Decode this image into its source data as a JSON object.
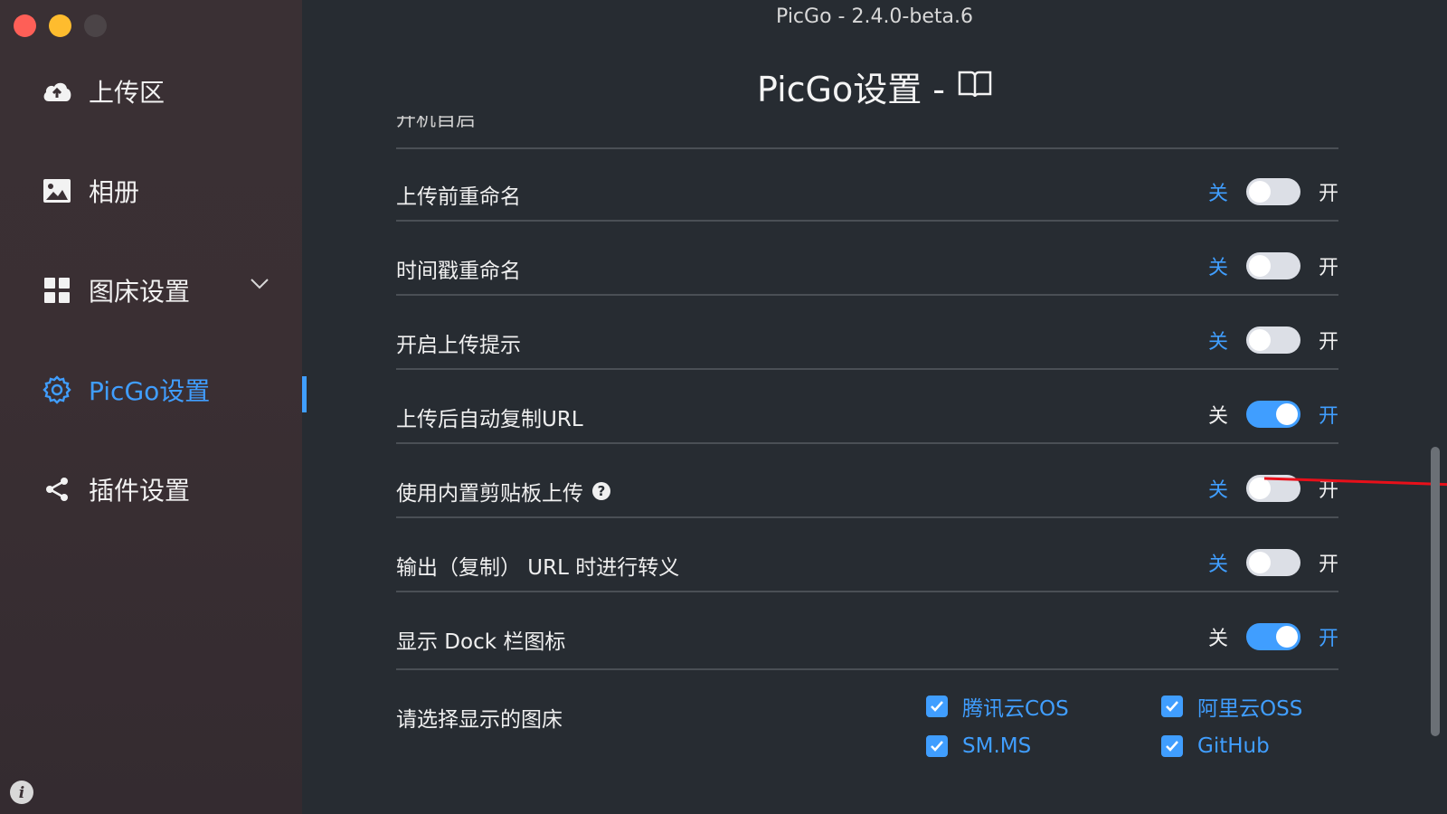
{
  "window": {
    "title": "PicGo - 2.4.0-beta.6"
  },
  "sidebar": {
    "items": [
      {
        "label": "上传区",
        "icon": "cloud-upload-icon"
      },
      {
        "label": "相册",
        "icon": "image-icon"
      },
      {
        "label": "图床设置",
        "icon": "grid-icon"
      },
      {
        "label": "PicGo设置",
        "icon": "gear-icon"
      },
      {
        "label": "插件设置",
        "icon": "share-icon"
      }
    ]
  },
  "page": {
    "title": "PicGo设置 -",
    "clipped_row_label": "开机自启"
  },
  "settings": [
    {
      "label": "上传前重命名",
      "off": "关",
      "on": "开",
      "checked": false
    },
    {
      "label": "时间戳重命名",
      "off": "关",
      "on": "开",
      "checked": false
    },
    {
      "label": "开启上传提示",
      "off": "关",
      "on": "开",
      "checked": false
    },
    {
      "label": "上传后自动复制URL",
      "off": "关",
      "on": "开",
      "checked": true
    },
    {
      "label": "使用内置剪贴板上传",
      "off": "关",
      "on": "开",
      "checked": false,
      "help": "?"
    },
    {
      "label": "输出（复制） URL 时进行转义",
      "off": "关",
      "on": "开",
      "checked": false
    },
    {
      "label": "显示 Dock 栏图标",
      "off": "关",
      "on": "开",
      "checked": true
    }
  ],
  "picbeds": {
    "label": "请选择显示的图床",
    "items": [
      {
        "label": "腾讯云COS",
        "checked": true
      },
      {
        "label": "阿里云OSS",
        "checked": true
      },
      {
        "label": "SM.MS",
        "checked": true
      },
      {
        "label": "GitHub",
        "checked": true
      }
    ]
  },
  "colors": {
    "accent": "#409eff",
    "background": "#272c32",
    "annotation_arrow": "#e8101a"
  }
}
